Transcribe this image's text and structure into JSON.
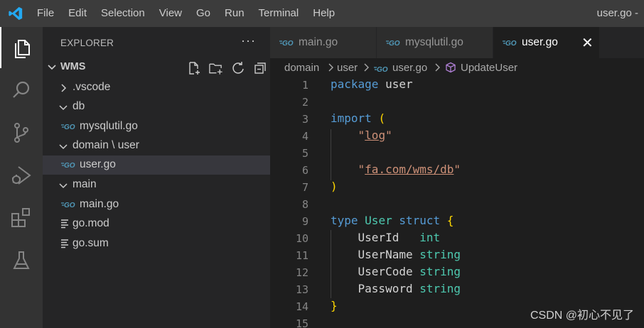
{
  "titlebar": {
    "menu": [
      "File",
      "Edit",
      "Selection",
      "View",
      "Go",
      "Run",
      "Terminal",
      "Help"
    ],
    "window_title": "user.go -"
  },
  "activitybar": {
    "icons": [
      "files-icon",
      "search-icon",
      "source-control-icon",
      "run-debug-icon",
      "extensions-icon",
      "testing-icon"
    ]
  },
  "sidebar": {
    "header": "EXPLORER",
    "more": "···",
    "folder": "WMS",
    "tree": [
      {
        "label": ".vscode",
        "type": "folder",
        "expanded": false
      },
      {
        "label": "db",
        "type": "folder",
        "expanded": true
      },
      {
        "label": "mysqlutil.go",
        "type": "go"
      },
      {
        "label": "domain \\ user",
        "type": "folder",
        "expanded": true
      },
      {
        "label": "user.go",
        "type": "go",
        "selected": true
      },
      {
        "label": "main",
        "type": "folder",
        "expanded": true
      },
      {
        "label": "main.go",
        "type": "go"
      },
      {
        "label": "go.mod",
        "type": "file"
      },
      {
        "label": "go.sum",
        "type": "file"
      }
    ]
  },
  "tabs": [
    {
      "label": "main.go",
      "active": false
    },
    {
      "label": "mysqlutil.go",
      "active": false
    },
    {
      "label": "user.go",
      "active": true,
      "close": "✕"
    }
  ],
  "breadcrumb": [
    "domain",
    "user",
    "user.go",
    "UpdateUser"
  ],
  "editor": {
    "line_numbers": [
      "1",
      "2",
      "3",
      "4",
      "5",
      "6",
      "7",
      "8",
      "9",
      "10",
      "11",
      "12",
      "13",
      "14",
      "15"
    ]
  },
  "watermark": "CSDN @初心不见了",
  "colors": {
    "keyword": "#569cd6",
    "type": "#4ec9b0",
    "string": "#ce9178",
    "bracket": "#ffd700",
    "accent": "#007acc"
  }
}
